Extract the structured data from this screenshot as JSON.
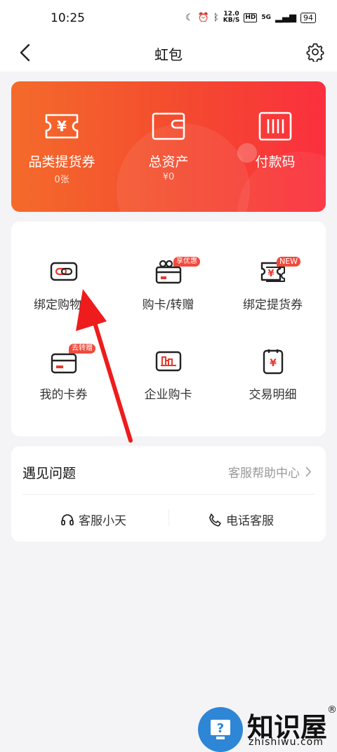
{
  "status": {
    "time": "10:25",
    "speed_top": "12.0",
    "speed_bottom": "KB/S",
    "hd": "HD",
    "net": "5G",
    "battery": "94"
  },
  "nav": {
    "title": "虹包"
  },
  "hero": {
    "items": [
      {
        "label": "品类提货券",
        "value": "0张"
      },
      {
        "label": "总资产",
        "value": "¥0"
      },
      {
        "label": "付款码",
        "value": ""
      }
    ]
  },
  "grid": {
    "items": [
      {
        "label": "绑定购物卡",
        "tag": ""
      },
      {
        "label": "购卡/转赠",
        "tag": "享优惠"
      },
      {
        "label": "绑定提货券",
        "tag": "NEW"
      },
      {
        "label": "我的卡券",
        "tag": "去转赠"
      },
      {
        "label": "企业购卡",
        "tag": ""
      },
      {
        "label": "交易明细",
        "tag": ""
      }
    ]
  },
  "help": {
    "title": "遇见问题",
    "link": "客服帮助中心",
    "service": "客服小天",
    "phone": "电话客服"
  },
  "watermark": {
    "brand": "知识屋",
    "domain": "zhishiwu.com",
    "reg": "®"
  },
  "colors": {
    "accent": "#f44a2f",
    "tag": "#f14a3d"
  }
}
